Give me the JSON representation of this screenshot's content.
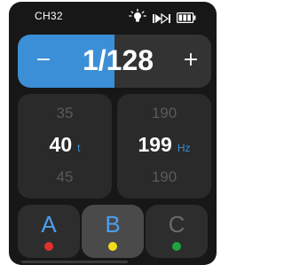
{
  "status_bar": {
    "channel": "CH32",
    "icons": [
      "bulb-icon",
      "rate-icon",
      "battery-icon"
    ]
  },
  "power": {
    "value": "1/128",
    "minus_label": "−",
    "plus_label": "+",
    "level": 0.5
  },
  "pickers": [
    {
      "prev": "35",
      "value": "40",
      "unit": "t",
      "next": "45"
    },
    {
      "prev": "190",
      "value": "199",
      "unit": "Hz",
      "next": "190"
    }
  ],
  "groups": [
    {
      "label": "A",
      "color": "#4aa0ec",
      "dot_color": "#e0322b",
      "active": false
    },
    {
      "label": "B",
      "color": "#4aa0ec",
      "dot_color": "#f2dc1a",
      "active": true
    },
    {
      "label": "C",
      "color": "#6a6a6a",
      "dot_color": "#1ea442",
      "active": false
    }
  ],
  "colors": {
    "accent": "#3a8fd7",
    "background": "#171717"
  }
}
